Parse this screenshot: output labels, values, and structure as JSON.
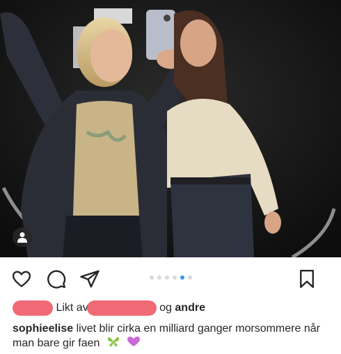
{
  "post": {
    "likes": {
      "prefix": "Likt av",
      "suffix": "og",
      "others": "andre"
    },
    "caption": {
      "username": "sophieelise",
      "text": "livet blir cirka en milliard ganger morsommere når man bare gir faen"
    },
    "carousel": {
      "total": 6,
      "active_index": 4
    },
    "colors": {
      "accent": "#3897f0",
      "redaction": "#f06a76",
      "text": "#262626"
    },
    "icons": [
      "heart-icon",
      "comment-icon",
      "share-icon",
      "bookmark-icon",
      "user-tag-icon",
      "butterfly-icon",
      "heart-emoji-icon"
    ]
  }
}
